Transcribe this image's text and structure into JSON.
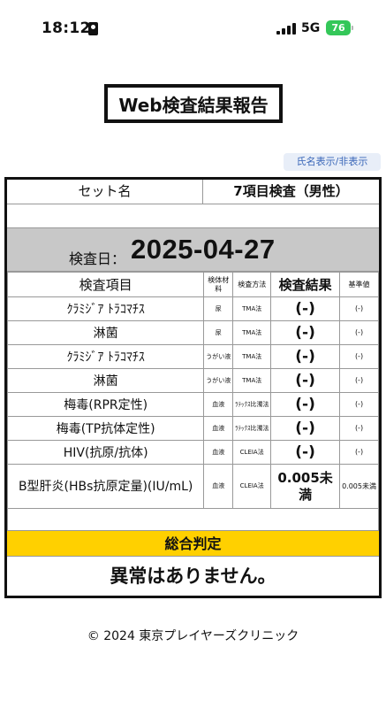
{
  "status_bar": {
    "time": "18:12",
    "network": "5G",
    "battery": "76"
  },
  "header": {
    "title": "Web検査結果報告"
  },
  "toggle_name": "氏名表示/非表示",
  "report": {
    "set_label": "セット名",
    "set_value": "7項目検査（男性）",
    "date_label": "検査日：",
    "date_value": "2025-04-27",
    "columns": {
      "item": "検査項目",
      "material": "検体材料",
      "method": "検査方法",
      "result": "検査結果",
      "reference": "基準値"
    },
    "rows": [
      {
        "item": "ｸﾗﾐｼﾞｱ ﾄﾗｺﾏﾁｽ",
        "material": "尿",
        "method": "TMA法",
        "result": "(-)",
        "reference": "(-)"
      },
      {
        "item": "淋菌",
        "material": "尿",
        "method": "TMA法",
        "result": "(-)",
        "reference": "(-)"
      },
      {
        "item": "ｸﾗﾐｼﾞｱ ﾄﾗｺﾏﾁｽ",
        "material": "うがい液",
        "method": "TMA法",
        "result": "(-)",
        "reference": "(-)"
      },
      {
        "item": "淋菌",
        "material": "うがい液",
        "method": "TMA法",
        "result": "(-)",
        "reference": "(-)"
      },
      {
        "item": "梅毒(RPR定性)",
        "material": "血液",
        "method": "ﾗﾃｯｸｽ比濁法",
        "result": "(-)",
        "reference": "(-)"
      },
      {
        "item": "梅毒(TP抗体定性)",
        "material": "血液",
        "method": "ﾗﾃｯｸｽ比濁法",
        "result": "(-)",
        "reference": "(-)"
      },
      {
        "item": "HIV(抗原/抗体)",
        "material": "血液",
        "method": "CLEIA法",
        "result": "(-)",
        "reference": "(-)"
      },
      {
        "item": "B型肝炎(HBs抗原定量)(IU/mL)",
        "material": "血液",
        "method": "CLEIA法",
        "result": "0.005未満",
        "reference": "0.005未満"
      }
    ],
    "verdict_label": "総合判定",
    "verdict_value": "異常はありません。"
  },
  "footer": "© 2024 東京プレイヤーズクリニック"
}
